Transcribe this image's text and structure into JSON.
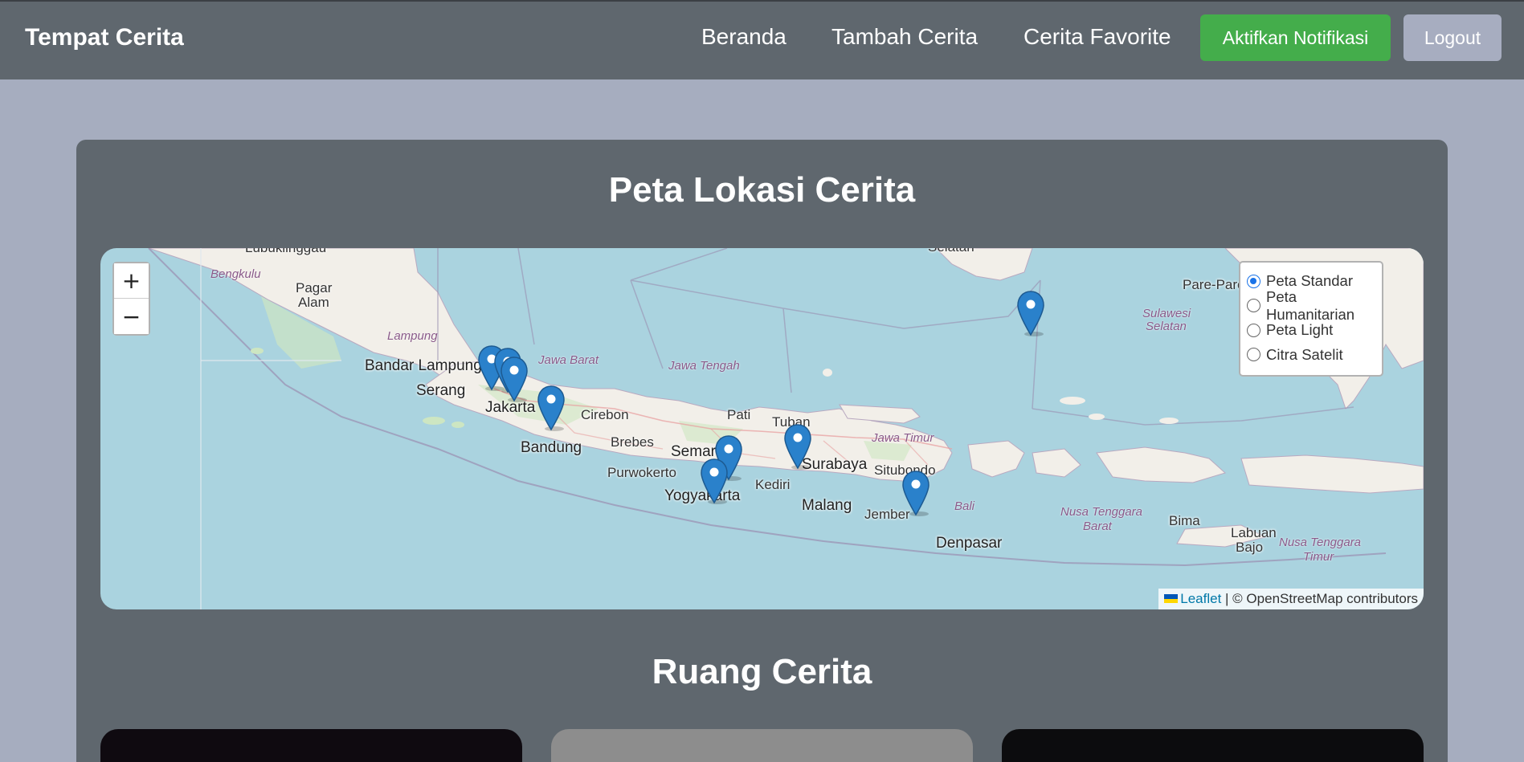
{
  "nav": {
    "brand": "Tempat Cerita",
    "links": [
      "Beranda",
      "Tambah Cerita",
      "Cerita Favorite"
    ],
    "notif_button": "Aktifkan Notifikasi",
    "logout_button": "Logout"
  },
  "map_section": {
    "title": "Peta Lokasi Cerita",
    "zoom_in": "+",
    "zoom_out": "−",
    "layers": [
      {
        "label": "Peta Standar",
        "checked": true
      },
      {
        "label": "Peta Humanitarian",
        "checked": false
      },
      {
        "label": "Peta Light",
        "checked": false
      },
      {
        "label": "Citra Satelit",
        "checked": false
      }
    ],
    "attribution": {
      "leaflet": "Leaflet",
      "rest": "| © OpenStreetMap contributors"
    },
    "places": {
      "lubuklinggau": "Lubuklinggau",
      "bengkulu": "Bengkulu",
      "pagar_alam": "Pagar",
      "pagar_alam_2": "Alam",
      "lampung": "Lampung",
      "bandar_lampung": "Bandar Lampung",
      "serang": "Serang",
      "jakarta": "Jakarta",
      "jawa_barat": "Jawa Barat",
      "jawa_tengah": "Jawa Tengah",
      "cirebon": "Cirebon",
      "bandung": "Bandung",
      "brebes": "Brebes",
      "pati": "Pati",
      "tuban": "Tuban",
      "semarang": "Semar",
      "purwokerto": "Purwokerto",
      "yogyakarta": "Yogyakarta",
      "kediri": "Kediri",
      "surabaya": "Surabaya",
      "jawa_timur": "Jawa Timur",
      "situbondo": "Situbondo",
      "malang": "Malang",
      "jember": "Jember",
      "bali": "Bali",
      "denpasar": "Denpasar",
      "ntb": "Nusa Tenggara",
      "ntb_2": "Barat",
      "bima": "Bima",
      "labuan_bajo": "Labuan",
      "labuan_bajo_2": "Bajo",
      "ntt": "Nusa Tenggara",
      "ntt_2": "Timur",
      "pare_pare": "Pare-Pare",
      "sulsel": "Sulawesi",
      "sulsel_2": "Selatan",
      "selatan_top": "Selatan"
    },
    "markers": [
      {
        "name": "marker-bogor-area-1"
      },
      {
        "name": "marker-bogor-area-2"
      },
      {
        "name": "marker-bogor-area-3"
      },
      {
        "name": "marker-bandung"
      },
      {
        "name": "marker-semarang"
      },
      {
        "name": "marker-yogyakarta"
      },
      {
        "name": "marker-tuban"
      },
      {
        "name": "marker-situbondo"
      },
      {
        "name": "marker-java-sea"
      }
    ]
  },
  "stories_section": {
    "title": "Ruang Cerita"
  },
  "colors": {
    "navbar": "#5f676e",
    "page_bg": "#a6adbf",
    "notif_button": "#44ad4b",
    "logout_button": "#a7adc0",
    "marker": "#2a81cb"
  }
}
